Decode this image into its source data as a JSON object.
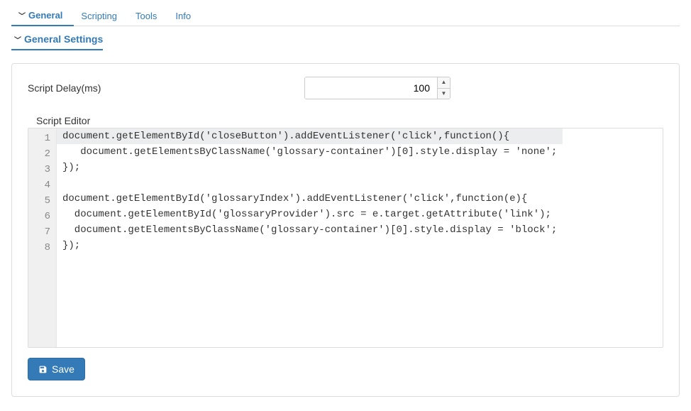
{
  "tabs": {
    "general": "General",
    "scripting": "Scripting",
    "tools": "Tools",
    "info": "Info"
  },
  "section": {
    "title": "General Settings"
  },
  "fields": {
    "script_delay_label": "Script Delay(ms)",
    "script_delay_value": "100",
    "editor_label": "Script Editor"
  },
  "code_lines": [
    "document.getElementById('closeButton').addEventListener('click',function(){",
    "   document.getElementsByClassName('glossary-container')[0].style.display = 'none';",
    "});",
    "",
    "document.getElementById('glossaryIndex').addEventListener('click',function(e){",
    "  document.getElementById('glossaryProvider').src = e.target.getAttribute('link');",
    "  document.getElementsByClassName('glossary-container')[0].style.display = 'block';",
    "});"
  ],
  "line_numbers": [
    "1",
    "2",
    "3",
    "4",
    "5",
    "6",
    "7",
    "8"
  ],
  "buttons": {
    "save": "Save"
  }
}
